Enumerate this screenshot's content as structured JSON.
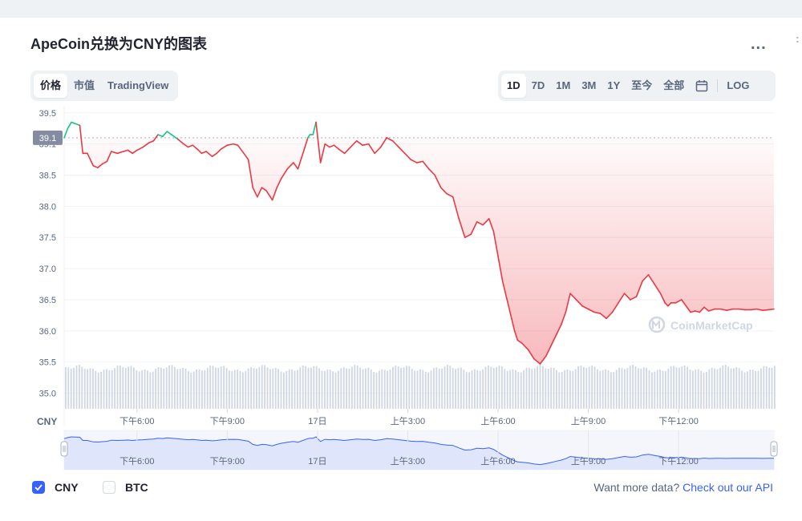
{
  "header": {
    "title": "ApeCoin兑换为CNY的图表",
    "more_label": "..."
  },
  "tabs_left": [
    {
      "label": "价格",
      "active": true
    },
    {
      "label": "市值",
      "active": false
    },
    {
      "label": "TradingView",
      "active": false
    }
  ],
  "tabs_right": [
    {
      "label": "1D",
      "active": true
    },
    {
      "label": "7D",
      "active": false
    },
    {
      "label": "1M",
      "active": false
    },
    {
      "label": "3M",
      "active": false
    },
    {
      "label": "1Y",
      "active": false
    },
    {
      "label": "至今",
      "active": false
    },
    {
      "label": "全部",
      "active": false
    }
  ],
  "log_label": "LOG",
  "icons": {
    "calendar": "calendar-icon",
    "more": "more-dots-icon",
    "check": "check-icon",
    "watermark": "coinmarketcap-logo-icon"
  },
  "colors": {
    "up": "#16c784",
    "down": "#ea3943",
    "brand": "#3861fb",
    "navigator_fill": "#dfe6fb",
    "navigator_line": "#3861fb",
    "volume": "#cfd6e4",
    "open_label_bg": "#858ca2"
  },
  "watermark": "CoinMarketCap",
  "chart_data": {
    "type": "line",
    "currency_label": "CNY",
    "open_value": 39.1,
    "open_value_label": "39.1",
    "y_ticks": [
      39.5,
      39.0,
      38.5,
      38.0,
      37.5,
      37.0,
      36.5,
      36.0,
      35.5,
      35.0
    ],
    "y_tick_labels": [
      "39.5",
      "39.1",
      "38.5",
      "38.0",
      "37.5",
      "37.0",
      "36.5",
      "36.0",
      "35.5",
      "35.0"
    ],
    "ylim": [
      34.75,
      39.6
    ],
    "x_range": [
      15.58,
      39.17
    ],
    "x_ticks": [
      {
        "x": 18,
        "label": "下午6:00"
      },
      {
        "x": 21,
        "label": "下午9:00"
      },
      {
        "x": 24,
        "label": "17日"
      },
      {
        "x": 27,
        "label": "上午3:00"
      },
      {
        "x": 30,
        "label": "上午6:00"
      },
      {
        "x": 33,
        "label": "上午9:00"
      },
      {
        "x": 36,
        "label": "下午12:00"
      }
    ],
    "series": [
      {
        "x": [
          15.58,
          15.7,
          15.82,
          15.93,
          16.1,
          16.2,
          16.35,
          16.55,
          16.7,
          16.85,
          17.0,
          17.15,
          17.35,
          17.55,
          17.7,
          17.85,
          18.0,
          18.2,
          18.4,
          18.55,
          18.7,
          18.85,
          19.0,
          19.15,
          19.35,
          19.55,
          19.7,
          19.85,
          20.0,
          20.15,
          20.3,
          20.5,
          20.65,
          20.8,
          21.0,
          21.2,
          21.35,
          21.55,
          21.7,
          21.85,
          22.0,
          22.15,
          22.3,
          22.5,
          22.65,
          22.8,
          23.0,
          23.2,
          23.35,
          23.55,
          23.68,
          23.75,
          23.85,
          23.95,
          24.1,
          24.25,
          24.4,
          24.55,
          24.7,
          24.9,
          25.1,
          25.3,
          25.5,
          25.7,
          25.9,
          26.1,
          26.3,
          26.5,
          26.7,
          26.9,
          27.1,
          27.3,
          27.5,
          27.7,
          27.9,
          28.1,
          28.3,
          28.5,
          28.7,
          28.9,
          29.1,
          29.3,
          29.5,
          29.7,
          29.85,
          30.0,
          30.15,
          30.3,
          30.45,
          30.55,
          30.65,
          30.8,
          31.0,
          31.2,
          31.4,
          31.6,
          31.75,
          31.85,
          31.95,
          32.1,
          32.25,
          32.4,
          32.6,
          32.8,
          33.0,
          33.2,
          33.4,
          33.6,
          33.8,
          34.0,
          34.2,
          34.4,
          34.6,
          34.8,
          35.0,
          35.2,
          35.4,
          35.55,
          35.65,
          35.75,
          35.9,
          36.1,
          36.25,
          36.4,
          36.55,
          36.7,
          36.85,
          37.0,
          37.2,
          37.4,
          37.6,
          37.8,
          38.0,
          38.2,
          38.4,
          38.6,
          38.8,
          39.0,
          39.17
        ],
        "y": [
          39.1,
          39.25,
          39.35,
          39.33,
          39.3,
          38.85,
          38.85,
          38.65,
          38.62,
          38.68,
          38.72,
          38.88,
          38.85,
          38.88,
          38.9,
          38.85,
          38.9,
          38.95,
          39.02,
          39.05,
          39.15,
          39.12,
          39.2,
          39.15,
          39.08,
          39.0,
          38.95,
          38.98,
          38.92,
          38.85,
          38.88,
          38.8,
          38.85,
          38.92,
          38.98,
          39.0,
          38.98,
          38.85,
          38.75,
          38.3,
          38.15,
          38.3,
          38.25,
          38.1,
          38.3,
          38.45,
          38.6,
          38.7,
          38.6,
          38.9,
          39.1,
          39.15,
          39.15,
          39.35,
          38.7,
          39.0,
          38.95,
          38.98,
          38.92,
          38.85,
          38.95,
          39.05,
          38.98,
          39.0,
          38.85,
          38.95,
          39.1,
          39.05,
          38.95,
          38.85,
          38.75,
          38.7,
          38.72,
          38.6,
          38.5,
          38.3,
          38.2,
          38.15,
          37.8,
          37.5,
          37.55,
          37.75,
          37.7,
          37.8,
          37.6,
          37.2,
          36.8,
          36.5,
          36.2,
          36.0,
          35.85,
          35.8,
          35.7,
          35.55,
          35.47,
          35.6,
          35.75,
          35.85,
          35.95,
          36.1,
          36.3,
          36.6,
          36.5,
          36.4,
          36.35,
          36.3,
          36.28,
          36.2,
          36.3,
          36.45,
          36.6,
          36.5,
          36.55,
          36.8,
          36.9,
          36.75,
          36.6,
          36.45,
          36.4,
          36.45,
          36.45,
          36.5,
          36.4,
          36.3,
          36.32,
          36.3,
          36.38,
          36.32,
          36.35,
          36.35,
          36.33,
          36.35,
          36.35,
          36.34,
          36.34,
          36.35,
          36.33,
          36.34,
          36.35
        ]
      }
    ]
  },
  "legend": [
    {
      "label": "CNY",
      "checked": true
    },
    {
      "label": "BTC",
      "checked": false
    }
  ],
  "footer": {
    "prompt": "Want more data?",
    "link": "Check out our API"
  }
}
